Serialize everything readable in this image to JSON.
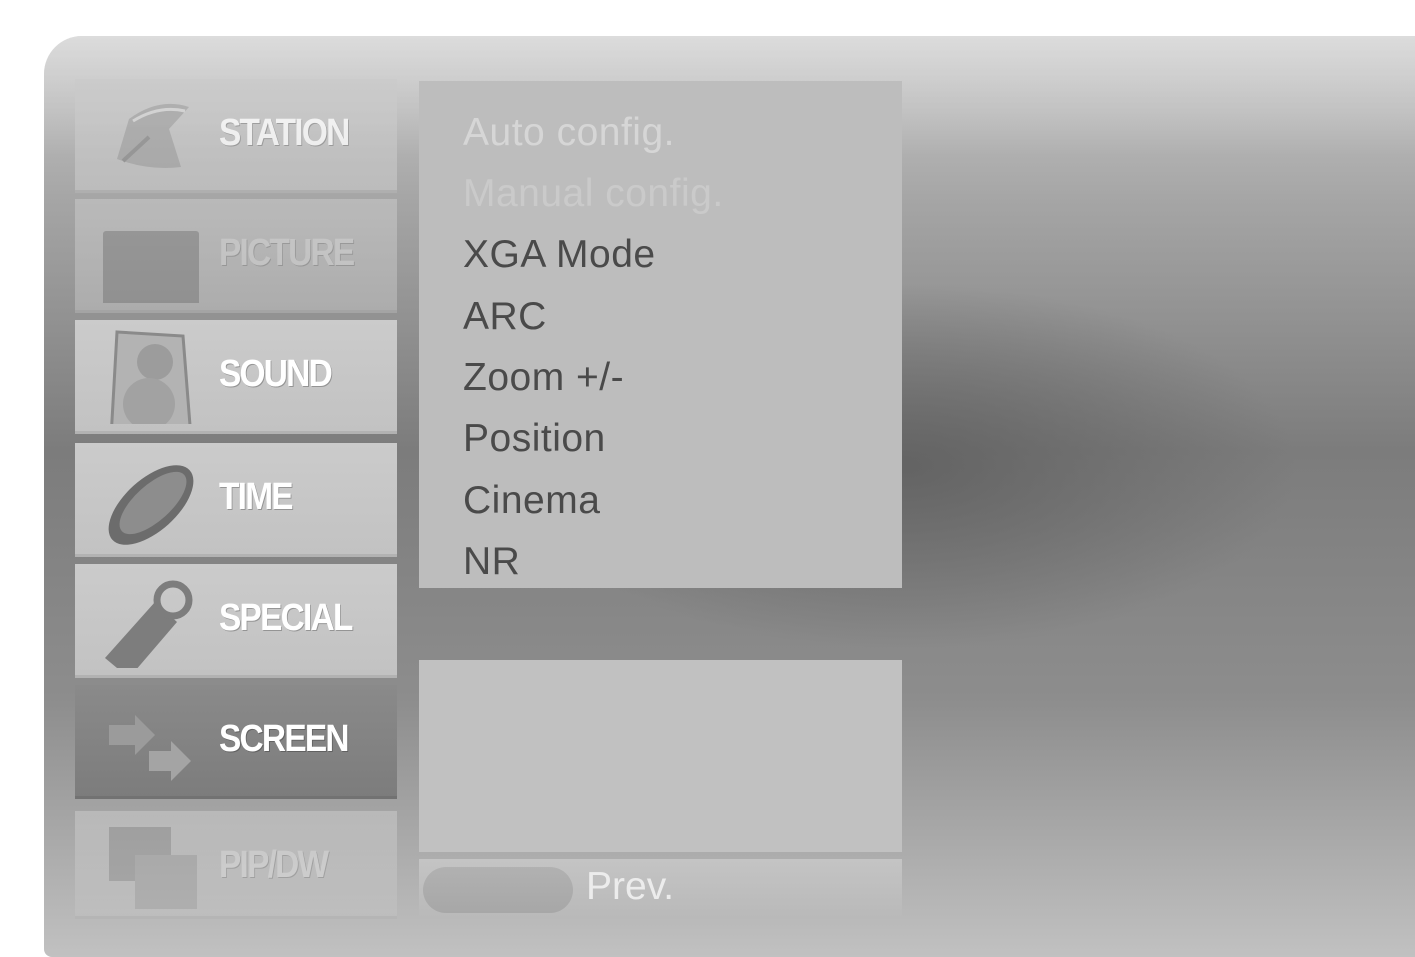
{
  "menu": {
    "items": [
      {
        "label": "STATION",
        "icon": "satellite-dish-icon"
      },
      {
        "label": "PICTURE",
        "icon": "tv-screen-icon"
      },
      {
        "label": "SOUND",
        "icon": "speaker-icon"
      },
      {
        "label": "TIME",
        "icon": "clock-dial-icon"
      },
      {
        "label": "SPECIAL",
        "icon": "tag-icon"
      },
      {
        "label": "SCREEN",
        "icon": "arrows-icon"
      },
      {
        "label": "PIP/DW",
        "icon": "pip-windows-icon"
      }
    ],
    "selected": "SCREEN"
  },
  "submenu": {
    "items": [
      "Auto config.",
      "Manual config.",
      "XGA Mode",
      "ARC",
      "Zoom +/-",
      "Position",
      "Cinema",
      "NR"
    ]
  },
  "footer": {
    "prev_label": "Prev."
  },
  "colors": {
    "panel": "#bdbdbd",
    "selected_tab": "#7c7c7c",
    "text": "#4a4a4a",
    "tab_text": "#ffffff"
  }
}
